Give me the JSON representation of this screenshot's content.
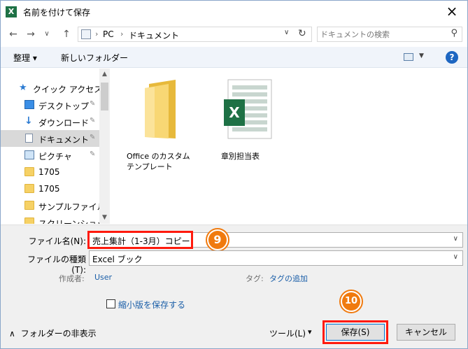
{
  "window": {
    "title": "名前を付けて保存",
    "app_icon": "X",
    "close_glyph": "×"
  },
  "nav": {
    "back": "←",
    "forward": "→",
    "recent": "∨",
    "up": "↑"
  },
  "address": {
    "crumbs": [
      "PC",
      "ドキュメント"
    ],
    "sep": "›",
    "dropdown_glyph": "∨",
    "refresh_glyph": "↻"
  },
  "search": {
    "placeholder": "ドキュメントの検索",
    "icon_glyph": "⚲"
  },
  "commandbar": {
    "organize": "整理 ▾",
    "new_folder": "新しいフォルダー",
    "view_dropdown": "▼",
    "help": "?"
  },
  "sidebar": {
    "items": [
      {
        "label": "クイック アクセス",
        "icon": "star-icon"
      },
      {
        "label": "デスクトップ",
        "icon": "desktop-icon",
        "pinned": true
      },
      {
        "label": "ダウンロード",
        "icon": "download-icon",
        "pinned": true
      },
      {
        "label": "ドキュメント",
        "icon": "document-icon",
        "pinned": true,
        "selected": true
      },
      {
        "label": "ピクチャ",
        "icon": "picture-icon",
        "pinned": true
      },
      {
        "label": "1705",
        "icon": "folder-icon"
      },
      {
        "label": "1705",
        "icon": "folder-icon"
      },
      {
        "label": "サンプルファイル",
        "icon": "folder-icon"
      },
      {
        "label": "スクリーンショット",
        "icon": "folder-icon"
      }
    ],
    "pin_glyph": "📌",
    "scroll_up": "▲",
    "scroll_down": "▼"
  },
  "files": [
    {
      "name": "Office のカスタム テンプレート",
      "icon": "folder-icon"
    },
    {
      "name": "章別担当表",
      "icon": "excel-file-icon"
    }
  ],
  "form": {
    "filename_label": "ファイル名(N):",
    "filename_value": "売上集計（1-3月）コピー",
    "filetype_label": "ファイルの種類(T):",
    "filetype_value": "Excel ブック",
    "dropdown_glyph": "∨",
    "author_label": "作成者:",
    "author_value": "User",
    "tags_label": "タグ:",
    "tags_value": "タグの追加",
    "thumbnail_label": "縮小版を保存する"
  },
  "footer": {
    "hide_folders": "フォルダーの非表示",
    "hide_glyph": "∧",
    "tools": "ツール(L)",
    "tools_dd": "▾",
    "save": "保存(S)",
    "cancel": "キャンセル"
  },
  "callouts": {
    "step9": "9",
    "step10": "10"
  },
  "colors": {
    "highlight": "#ff1a0d",
    "callout": "#f07a0e",
    "excel_green": "#1e7145"
  }
}
